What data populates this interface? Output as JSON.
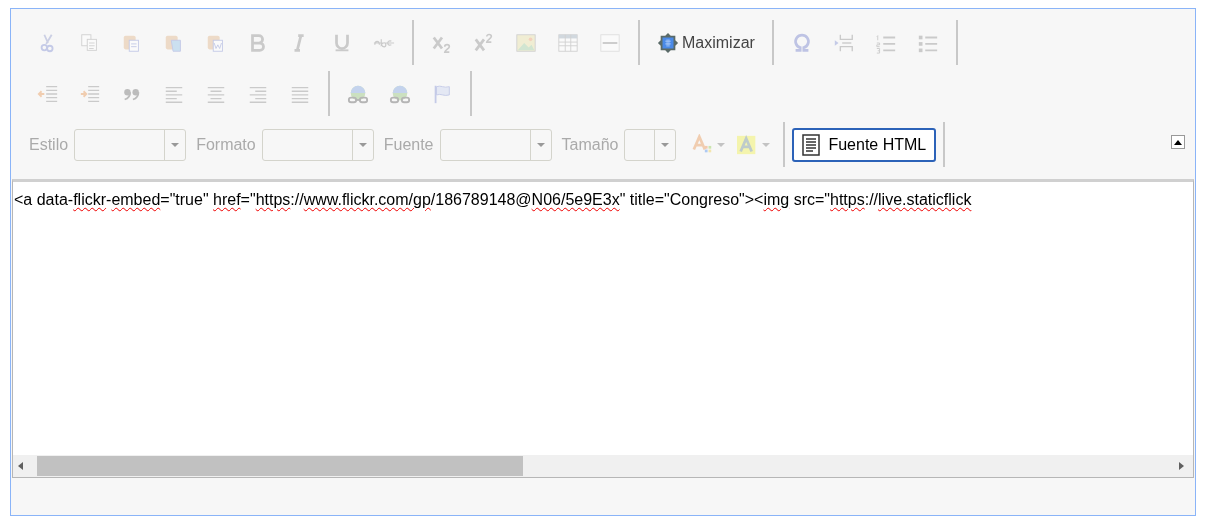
{
  "toolbar": {
    "rows": [
      [
        {
          "buttons": [
            {
              "kind": "cut",
              "disabled": true
            },
            {
              "kind": "copy",
              "disabled": true
            },
            {
              "kind": "paste",
              "disabled": true
            },
            {
              "kind": "paste-text",
              "disabled": true
            },
            {
              "kind": "paste-word",
              "disabled": true
            },
            {
              "kind": "bold",
              "disabled": true
            },
            {
              "kind": "italic",
              "disabled": true
            },
            {
              "kind": "underline",
              "disabled": true
            },
            {
              "kind": "strike",
              "disabled": true
            }
          ]
        },
        {
          "buttons": [
            {
              "kind": "subscript",
              "disabled": true
            },
            {
              "kind": "superscript",
              "disabled": true
            },
            {
              "kind": "image",
              "disabled": true
            },
            {
              "kind": "table",
              "disabled": true
            },
            {
              "kind": "rule",
              "disabled": true
            }
          ]
        },
        {
          "buttons": [
            {
              "kind": "maximize",
              "disabled": false,
              "label": "Maximizar"
            }
          ]
        },
        {
          "buttons": [
            {
              "kind": "omega",
              "disabled": true
            },
            {
              "kind": "pagebreak",
              "disabled": true
            },
            {
              "kind": "numbered-list",
              "disabled": true
            },
            {
              "kind": "bulleted-list",
              "disabled": true
            }
          ]
        }
      ],
      [
        {
          "buttons": [
            {
              "kind": "outdent",
              "disabled": true
            },
            {
              "kind": "indent",
              "disabled": true
            },
            {
              "kind": "quote",
              "disabled": true
            },
            {
              "kind": "align-left",
              "disabled": true
            },
            {
              "kind": "align-center",
              "disabled": true
            },
            {
              "kind": "align-right",
              "disabled": true
            },
            {
              "kind": "justify",
              "disabled": true
            }
          ]
        },
        {
          "buttons": [
            {
              "kind": "link",
              "disabled": true
            },
            {
              "kind": "unlink",
              "disabled": true
            },
            {
              "kind": "flag",
              "disabled": true
            }
          ]
        }
      ]
    ],
    "combos": [
      {
        "label": "Estilo",
        "disabled": true
      },
      {
        "label": "Formato",
        "disabled": true
      },
      {
        "label": "Fuente",
        "disabled": true
      },
      {
        "label": "Tamaño",
        "disabled": true
      }
    ],
    "color_buttons": [
      {
        "kind": "text-color",
        "disabled": true
      },
      {
        "kind": "bg-color",
        "disabled": true
      }
    ],
    "source_button": {
      "label": "Fuente HTML",
      "selected": true
    }
  },
  "source": [
    {
      "text": "<a data-",
      "misspelled": false
    },
    {
      "text": "flickr",
      "misspelled": true
    },
    {
      "text": "-",
      "misspelled": false
    },
    {
      "text": "embed",
      "misspelled": true
    },
    {
      "text": "=\"true\" ",
      "misspelled": false
    },
    {
      "text": "href",
      "misspelled": true
    },
    {
      "text": "=\"",
      "misspelled": false
    },
    {
      "text": "https",
      "misspelled": true
    },
    {
      "text": "://",
      "misspelled": false
    },
    {
      "text": "www.flickr.com/gp",
      "misspelled": true
    },
    {
      "text": "/186789148@",
      "misspelled": false
    },
    {
      "text": "N06/5e9E3x",
      "misspelled": true
    },
    {
      "text": "\" title=\"Congreso\"><",
      "misspelled": false
    },
    {
      "text": "img",
      "misspelled": true
    },
    {
      "text": " src=\"",
      "misspelled": false
    },
    {
      "text": "https",
      "misspelled": true
    },
    {
      "text": "://",
      "misspelled": false
    },
    {
      "text": "live.staticflick",
      "misspelled": true
    }
  ]
}
